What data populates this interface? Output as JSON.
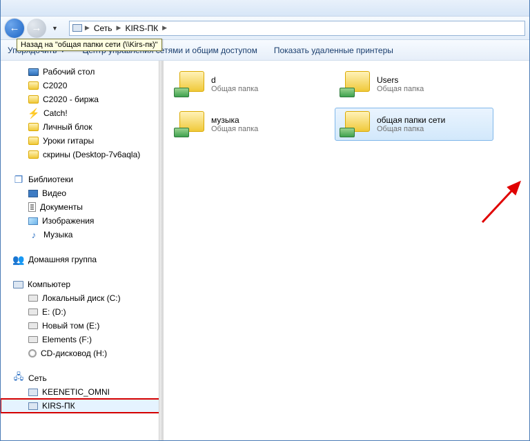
{
  "tooltip": "Назад на \"общая папки сети (\\\\Kirs-пк)\"",
  "breadcrumb": {
    "root": "Сеть",
    "node": "KIRS-ПК"
  },
  "toolbar": {
    "organize": "Упорядочить",
    "network_center": "Центр управления сетями и общим доступом",
    "printers": "Показать удаленные принтеры"
  },
  "tree": {
    "favorites": [
      {
        "label": "Рабочий стол",
        "icon": "desktop"
      },
      {
        "label": "C2020",
        "icon": "folder"
      },
      {
        "label": "C2020 - биржа",
        "icon": "folder"
      },
      {
        "label": "Catch!",
        "icon": "catch"
      },
      {
        "label": "Личный блок",
        "icon": "folder"
      },
      {
        "label": "Уроки гитары",
        "icon": "folder"
      },
      {
        "label": "скрины (Desktop-7v6aqla)",
        "icon": "folder"
      }
    ],
    "libraries_header": "Библиотеки",
    "libraries": [
      {
        "label": "Видео",
        "icon": "video"
      },
      {
        "label": "Документы",
        "icon": "doc"
      },
      {
        "label": "Изображения",
        "icon": "img"
      },
      {
        "label": "Музыка",
        "icon": "music"
      }
    ],
    "homegroup": "Домашняя группа",
    "computer_header": "Компьютер",
    "drives": [
      {
        "label": "Локальный диск (C:)",
        "icon": "disk"
      },
      {
        "label": "E: (D:)",
        "icon": "disk"
      },
      {
        "label": "Новый том (E:)",
        "icon": "disk"
      },
      {
        "label": "Elements (F:)",
        "icon": "disk"
      },
      {
        "label": "CD-дисковод (H:)",
        "icon": "cd"
      }
    ],
    "network_header": "Сеть",
    "network": [
      {
        "label": "KEENETIC_OMNI"
      },
      {
        "label": "KIRS-ПК"
      }
    ]
  },
  "shares": {
    "subtitle": "Общая папка",
    "items": [
      {
        "name": "d"
      },
      {
        "name": "Users"
      },
      {
        "name": "музыка"
      },
      {
        "name": "общая папки сети",
        "selected": true
      }
    ]
  }
}
